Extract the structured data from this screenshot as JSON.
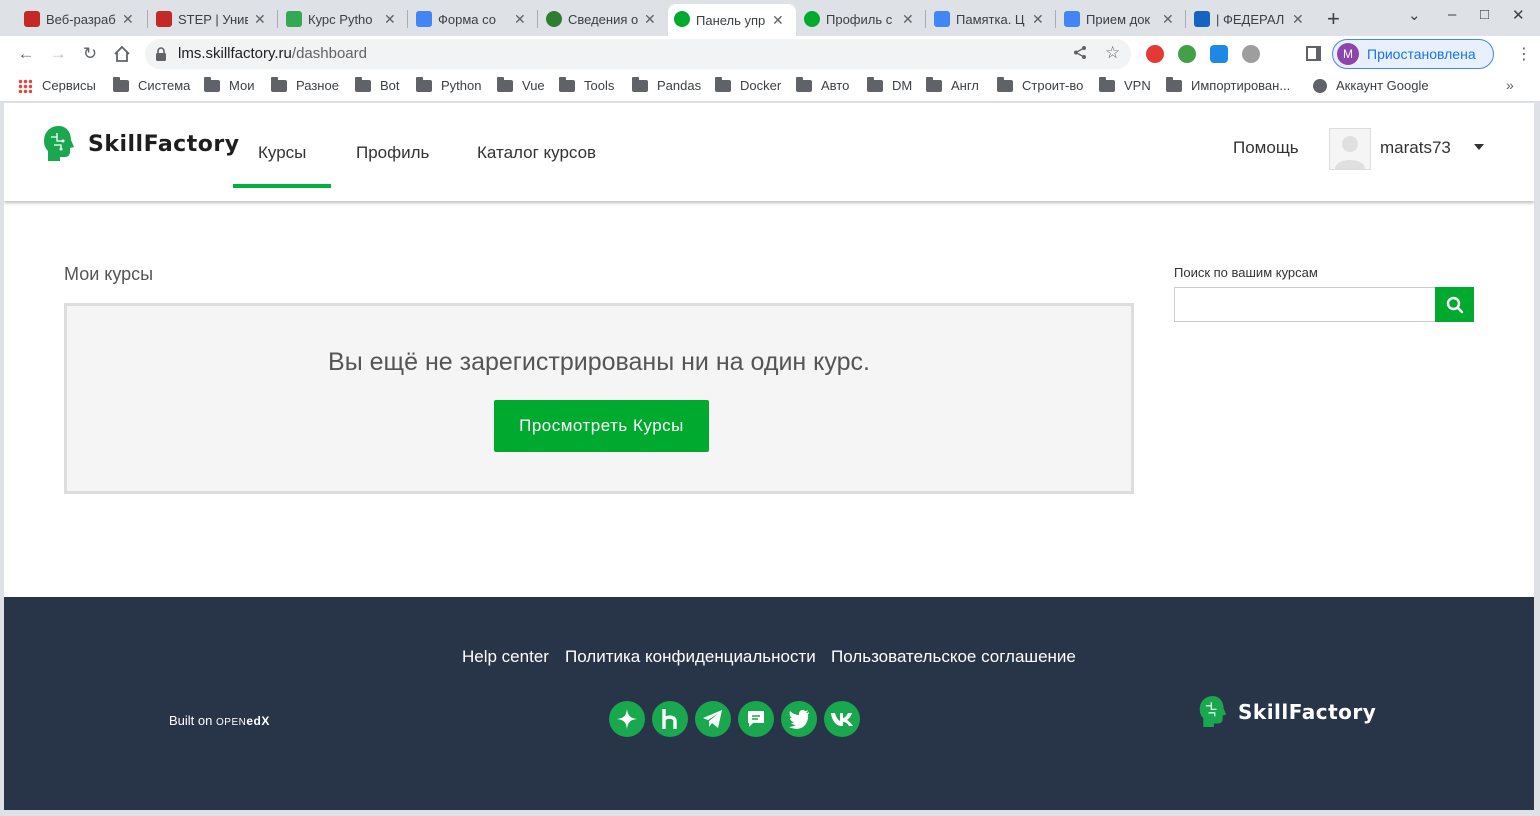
{
  "browser": {
    "tabs": [
      {
        "label": "Веб-разраб",
        "favicon": "2035-icon",
        "color": "#c62828",
        "active": false
      },
      {
        "label": "STEP | Унив",
        "favicon": "2035-icon",
        "color": "#c62828",
        "active": false
      },
      {
        "label": "Курс Pytho",
        "favicon": "green-square-icon",
        "color": "#34a853",
        "active": false
      },
      {
        "label": "Форма со",
        "favicon": "forms-icon",
        "color": "#4285f4",
        "active": false
      },
      {
        "label": "Сведения о",
        "favicon": "leaf-icon",
        "color": "#2e7d32",
        "active": false
      },
      {
        "label": "Панель упр",
        "favicon": "sf-icon",
        "color": "#00aa2f",
        "active": true
      },
      {
        "label": "Профиль с",
        "favicon": "sf-icon",
        "color": "#00aa2f",
        "active": false
      },
      {
        "label": "Памятка. Ц",
        "favicon": "docs-icon",
        "color": "#4285f4",
        "active": false
      },
      {
        "label": "Прием док",
        "favicon": "forms-icon",
        "color": "#4285f4",
        "active": false
      },
      {
        "label": "| ФЕДЕРАЛ",
        "favicon": "shield-icon",
        "color": "#1565c0",
        "active": false
      }
    ],
    "url_host": "lms.skillfactory.ru",
    "url_path": "/dashboard",
    "profile_initial": "М",
    "profile_status": "Приостановлена",
    "bookmarks": [
      {
        "label": "Сервисы",
        "icon": "apps-grid-icon"
      },
      {
        "label": "Система",
        "icon": "folder-icon"
      },
      {
        "label": "Мои",
        "icon": "folder-icon"
      },
      {
        "label": "Разное",
        "icon": "folder-icon"
      },
      {
        "label": "Bot",
        "icon": "folder-icon"
      },
      {
        "label": "Python",
        "icon": "folder-icon"
      },
      {
        "label": "Vue",
        "icon": "folder-icon"
      },
      {
        "label": "Tools",
        "icon": "folder-icon"
      },
      {
        "label": "Pandas",
        "icon": "folder-icon"
      },
      {
        "label": "Docker",
        "icon": "folder-icon"
      },
      {
        "label": "Авто",
        "icon": "folder-icon"
      },
      {
        "label": "DM",
        "icon": "folder-icon"
      },
      {
        "label": "Англ",
        "icon": "folder-icon"
      },
      {
        "label": "Строит-во",
        "icon": "folder-icon"
      },
      {
        "label": "VPN",
        "icon": "folder-icon"
      },
      {
        "label": "Импортирован...",
        "icon": "folder-icon"
      },
      {
        "label": "Аккаунт Google",
        "icon": "google-icon"
      }
    ]
  },
  "site": {
    "logo_text": "SkillFactory",
    "nav": {
      "courses": "Курсы",
      "profile": "Профиль",
      "catalog": "Каталог курсов"
    },
    "help": "Помощь",
    "username": "marats73",
    "accent": "#00aa2f"
  },
  "main": {
    "heading": "Мои курсы",
    "empty_message": "Вы ещё не зарегистрированы ни на один курс.",
    "browse_button": "Просмотреть Курсы",
    "search_label": "Поиск по вашим курсам",
    "search_value": ""
  },
  "footer": {
    "links": [
      "Help center",
      "Политика конфиденциальности",
      "Пользовательское соглашение"
    ],
    "built_on": "Built on",
    "openedx_prefix": "OPEN",
    "openedx_suffix": "edX",
    "social": [
      "star-icon",
      "habr-icon",
      "telegram-icon",
      "chat-icon",
      "twitter-icon",
      "vk-icon"
    ],
    "logo_text": "SkillFactory",
    "background": "#283447"
  }
}
